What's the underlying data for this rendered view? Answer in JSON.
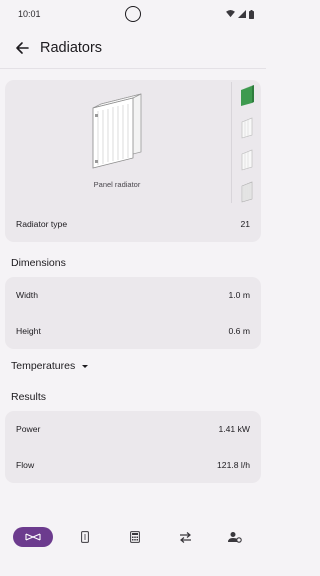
{
  "status": {
    "time": "10:01"
  },
  "header": {
    "title": "Radiators"
  },
  "radiator_type": {
    "caption": "Panel radiator",
    "label": "Radiator type",
    "value": "21"
  },
  "dimensions": {
    "title": "Dimensions",
    "width_label": "Width",
    "width_value": "1.0 m",
    "height_label": "Height",
    "height_value": "0.6 m"
  },
  "temperatures": {
    "title": "Temperatures"
  },
  "results": {
    "title": "Results",
    "power_label": "Power",
    "power_value": "1.41 kW",
    "flow_label": "Flow",
    "flow_value": "121.8 l/h"
  },
  "colors": {
    "accent": "#6c3b8e",
    "selected_thumb": "#3e9a4f",
    "card": "#ebe8ec",
    "background": "#f5f3f6"
  },
  "icons": {
    "status": [
      "wifi-icon",
      "signal-icon",
      "battery-icon"
    ],
    "nav": [
      "radiator-icon",
      "pipe-icon",
      "calculator-icon",
      "swap-icon",
      "user-settings-icon"
    ]
  }
}
